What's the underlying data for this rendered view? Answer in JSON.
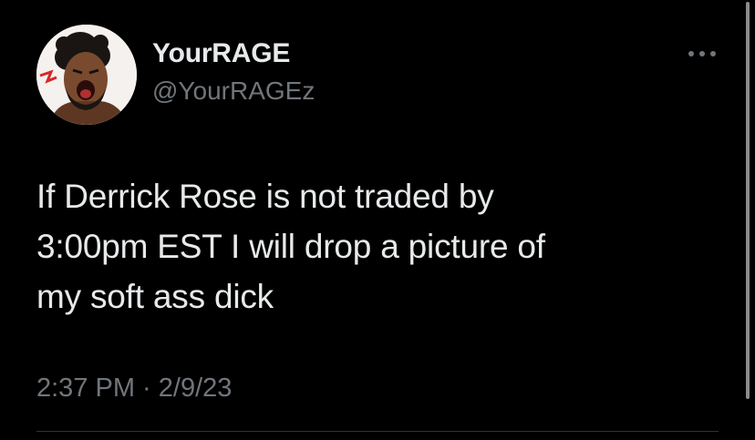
{
  "tweet": {
    "display_name": "YourRAGE",
    "handle": "@YourRAGEz",
    "text": "If Derrick Rose is not traded by\n3:00pm EST I will drop a picture of\nmy soft ass dick",
    "timestamp": "2:37 PM · 2/9/23",
    "avatar_icon": "cartoon-avatar-icon",
    "more_icon": "more-options-icon"
  },
  "colors": {
    "background": "#000000",
    "primary_text": "#e7e9ea",
    "secondary_text": "#71767b",
    "divider": "#2f3336"
  }
}
